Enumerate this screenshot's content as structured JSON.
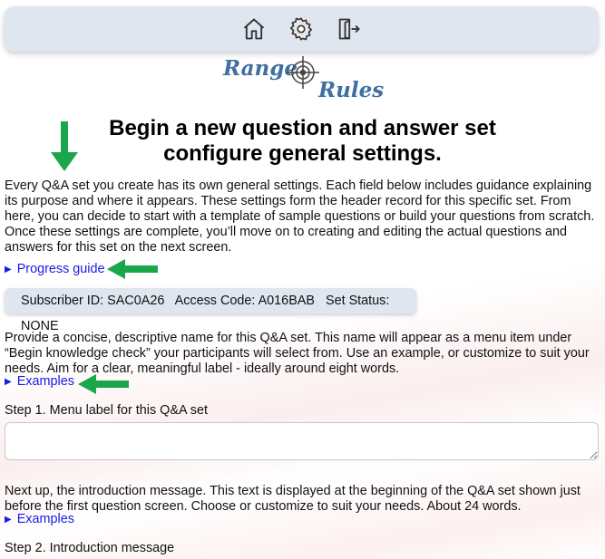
{
  "nav": {
    "home_icon": "home-icon",
    "settings_icon": "gear-icon",
    "logout_icon": "exit-icon"
  },
  "logo": {
    "word1": "Range",
    "word2": "Rules"
  },
  "heading": {
    "line1": "Begin a new question and answer set",
    "line2": "configure general settings."
  },
  "intro": "Every Q&A set you create has its own general settings. Each field below includes guidance explaining its purpose and where it appears. These settings form the header record for this specific set. From here, you can decide to start with a template of sample questions or build your questions from scratch. Once these settings are complete, you’ll move on to creating and editing the actual questions and answers for this set on the next screen.",
  "progress_guide": "Progress guide",
  "status": {
    "subscriber": "Subscriber ID: SAC0A26",
    "access": "Access Code: A016BAB",
    "set_status": "Set Status: NONE"
  },
  "step1": {
    "description": "Provide a concise, descriptive name for this Q&A set. This name will appear as a menu item under “Begin knowledge check” your participants will select from. Use an example, or customize to suit your needs. Aim for a clear, meaningful label - ideally around eight words.",
    "examples": "Examples",
    "label": "Step 1. Menu label for this Q&A set",
    "value": ""
  },
  "step2": {
    "description": "Next up, the introduction message. This text is displayed at the beginning of the Q&A set shown just before the first question screen. Choose or customize to suit your needs. About 24 words.",
    "examples": "Examples",
    "label": "Step 2. Introduction message"
  },
  "colors": {
    "accent_arrow": "#1aa64a",
    "link": "#1a1ae6",
    "panel": "#dfe6ef",
    "logo": "#3e6fa0"
  }
}
